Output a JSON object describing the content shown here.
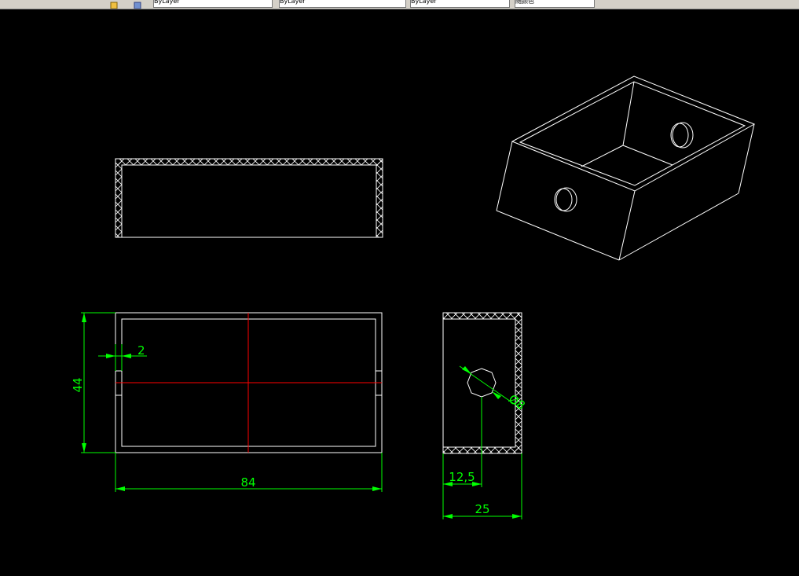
{
  "toolbar": {
    "fields": [
      {
        "value": "ByLayer"
      },
      {
        "value": "ByLayer"
      },
      {
        "value": "ByLayer"
      },
      {
        "value": "随颜色"
      }
    ]
  },
  "colors": {
    "background": "#000000",
    "geometry": "#ffffff",
    "dimension": "#00ff00",
    "centerline": "#ff0000"
  },
  "drawing": {
    "dimensions": {
      "wall_thickness": "2",
      "height": "44",
      "length": "84",
      "hole_diameter": "Ø8",
      "hole_offset": "12,5",
      "width": "25"
    }
  }
}
